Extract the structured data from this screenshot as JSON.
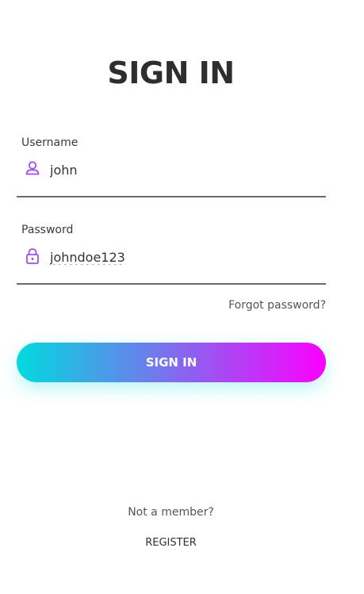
{
  "title": "SIGN IN",
  "username": {
    "label": "Username",
    "value": "john",
    "icon": "user-icon"
  },
  "password": {
    "label": "Password",
    "value": "johndoe123",
    "icon": "lock-icon"
  },
  "forgot_link": "Forgot password?",
  "signin_button": "SIGN IN",
  "footer": {
    "prompt": "Not a member?",
    "register_link": "REGISTER"
  },
  "colors": {
    "gradient_start": "#00dbde",
    "gradient_end": "#fc00ff",
    "icon": "#a64bf4"
  }
}
